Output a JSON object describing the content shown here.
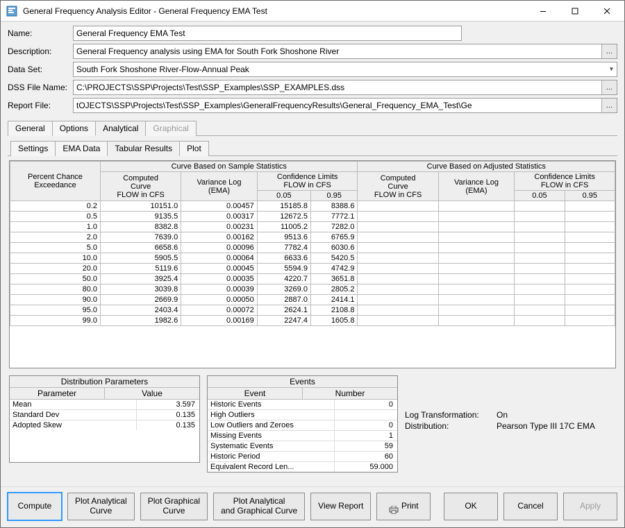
{
  "window": {
    "title": "General Frequency Analysis Editor - General Frequency EMA Test"
  },
  "fields": {
    "name_label": "Name:",
    "name": "General Frequency EMA Test",
    "desc_label": "Description:",
    "desc": "General Frequency analysis using EMA for South Fork Shoshone River",
    "dataset_label": "Data Set:",
    "dataset": "South Fork Shoshone River-Flow-Annual Peak",
    "dssfile_label": "DSS File Name:",
    "dssfile": "C:\\PROJECTS\\SSP\\Projects\\Test\\SSP_Examples\\SSP_EXAMPLES.dss",
    "report_label": "Report File:",
    "report": "tOJECTS\\SSP\\Projects\\Test\\SSP_Examples\\GeneralFrequencyResults\\General_Frequency_EMA_Test\\Ge"
  },
  "tabs_top": {
    "general": "General",
    "options": "Options",
    "analytical": "Analytical",
    "graphical": "Graphical"
  },
  "subtabs": {
    "settings": "Settings",
    "emadata": "EMA Data",
    "tabular": "Tabular Results",
    "plot": "Plot"
  },
  "main_table": {
    "hdr_pct": "Percent Chance\nExceedance",
    "hdr_sample": "Curve Based on Sample Statistics",
    "hdr_adjusted": "Curve Based on Adjusted Statistics",
    "hdr_computed": "Computed\nCurve\nFLOW in CFS",
    "hdr_varlog": "Variance Log\n(EMA)",
    "hdr_conf": "Confidence Limits\nFLOW in CFS",
    "hdr_c05": "0.05",
    "hdr_c95": "0.95",
    "rows": [
      {
        "p": "0.2",
        "c": "10151.0",
        "v": "0.00457",
        "l": "15185.8",
        "u": "8388.6"
      },
      {
        "p": "0.5",
        "c": "9135.5",
        "v": "0.00317",
        "l": "12672.5",
        "u": "7772.1"
      },
      {
        "p": "1.0",
        "c": "8382.8",
        "v": "0.00231",
        "l": "11005.2",
        "u": "7282.0"
      },
      {
        "p": "2.0",
        "c": "7639.0",
        "v": "0.00162",
        "l": "9513.6",
        "u": "6765.9"
      },
      {
        "p": "5.0",
        "c": "6658.6",
        "v": "0.00096",
        "l": "7782.4",
        "u": "6030.6"
      },
      {
        "p": "10.0",
        "c": "5905.5",
        "v": "0.00064",
        "l": "6633.6",
        "u": "5420.5"
      },
      {
        "p": "20.0",
        "c": "5119.6",
        "v": "0.00045",
        "l": "5594.9",
        "u": "4742.9"
      },
      {
        "p": "50.0",
        "c": "3925.4",
        "v": "0.00035",
        "l": "4220.7",
        "u": "3651.8"
      },
      {
        "p": "80.0",
        "c": "3039.8",
        "v": "0.00039",
        "l": "3269.0",
        "u": "2805.2"
      },
      {
        "p": "90.0",
        "c": "2669.9",
        "v": "0.00050",
        "l": "2887.0",
        "u": "2414.1"
      },
      {
        "p": "95.0",
        "c": "2403.4",
        "v": "0.00072",
        "l": "2624.1",
        "u": "2108.8"
      },
      {
        "p": "99.0",
        "c": "1982.6",
        "v": "0.00169",
        "l": "2247.4",
        "u": "1605.8"
      }
    ]
  },
  "dist_params": {
    "title": "Distribution Parameters",
    "h1": "Parameter",
    "h2": "Value",
    "rows": [
      {
        "k": "Mean",
        "v": "3.597"
      },
      {
        "k": "Standard Dev",
        "v": "0.135"
      },
      {
        "k": "Adopted Skew",
        "v": "0.135"
      }
    ]
  },
  "events": {
    "title": "Events",
    "h1": "Event",
    "h2": "Number",
    "rows": [
      {
        "k": "Historic Events",
        "v": "0"
      },
      {
        "k": "High Outliers",
        "v": ""
      },
      {
        "k": "Low Outliers and Zeroes",
        "v": "0"
      },
      {
        "k": "Missing Events",
        "v": "1"
      },
      {
        "k": "Systematic Events",
        "v": "59"
      },
      {
        "k": "Historic Period",
        "v": "60"
      },
      {
        "k": "Equivalent Record Len...",
        "v": "59.000"
      }
    ]
  },
  "meta": {
    "logtrans_label": "Log Transformation:",
    "logtrans": "On",
    "dist_label": "Distribution:",
    "dist": "Pearson Type III 17C EMA"
  },
  "buttons": {
    "compute": "Compute",
    "plot_analytical": "Plot Analytical\nCurve",
    "plot_graphical": "Plot Graphical\nCurve",
    "plot_both": "Plot Analytical\nand Graphical Curve",
    "view_report": "View Report",
    "print": "Print",
    "ok": "OK",
    "cancel": "Cancel",
    "apply": "Apply"
  },
  "icons": {
    "browse": "…",
    "caret": "▾"
  }
}
